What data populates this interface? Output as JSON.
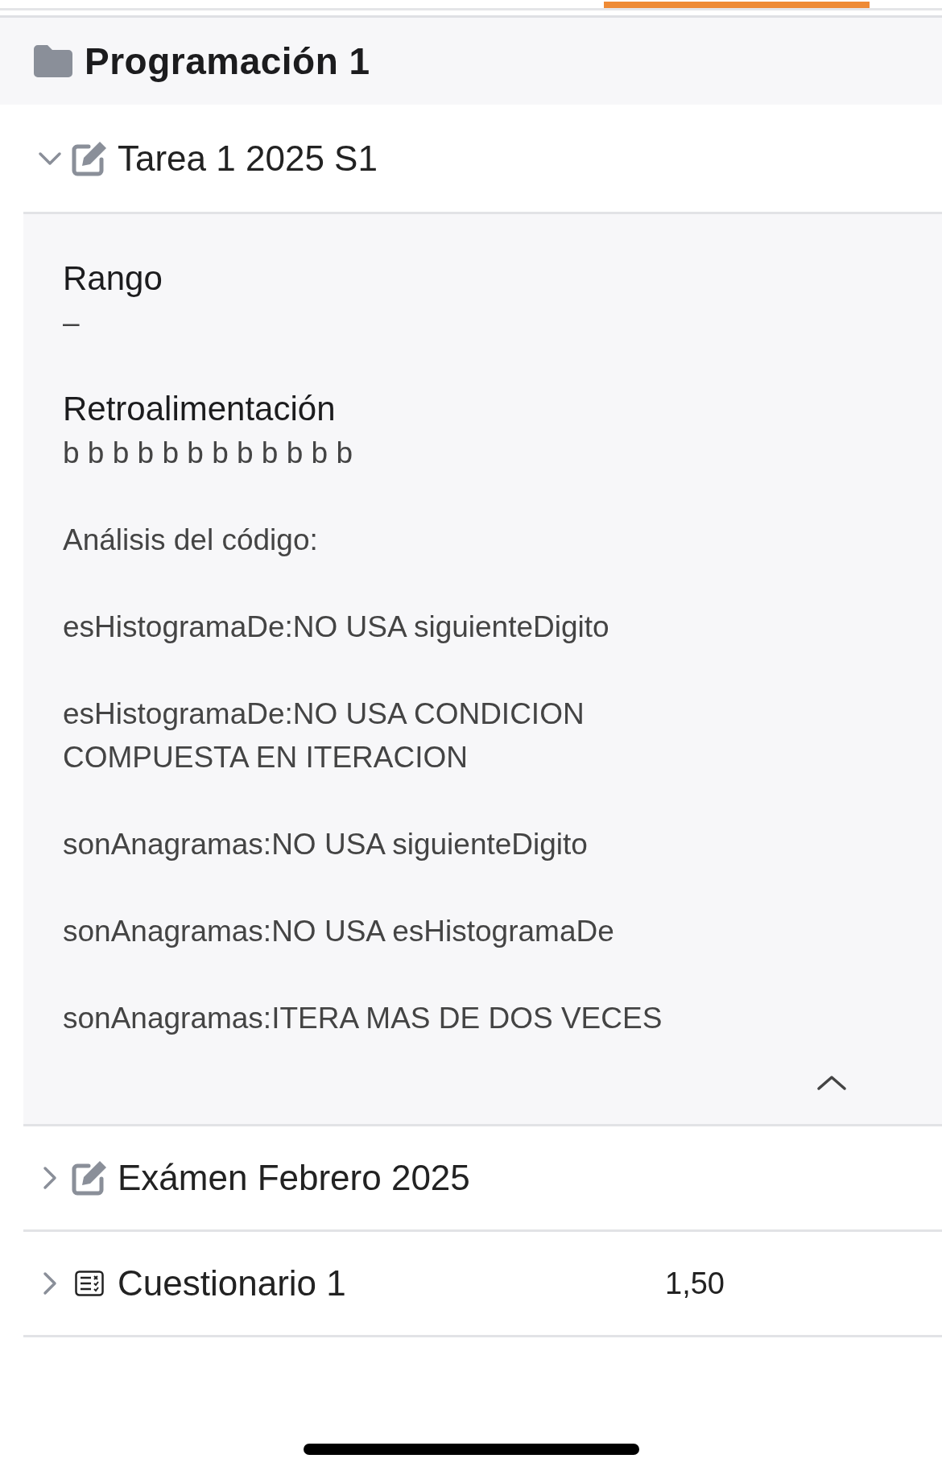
{
  "course": {
    "title": "Programación 1"
  },
  "items": [
    {
      "kind": "assignment",
      "title": "Tarea 1 2025 S1",
      "expanded": true,
      "details": [
        {
          "label": "Rango",
          "paragraphs": [
            "–"
          ]
        },
        {
          "label": "Retroalimentación",
          "paragraphs": [
            "b b b b b b b b b b b b",
            "Análisis del código:",
            "esHistogramaDe:NO USA siguienteDigito",
            "esHistogramaDe:NO USA CONDICION COMPUESTA EN ITERACION",
            "sonAnagramas:NO USA siguienteDigito",
            "sonAnagramas:NO USA esHistogramaDe",
            "sonAnagramas:ITERA MAS DE DOS VECES"
          ]
        }
      ]
    },
    {
      "kind": "assignment",
      "title": "Exámen Febrero 2025",
      "expanded": false
    },
    {
      "kind": "quiz",
      "title": "Cuestionario 1",
      "grade": "1,50",
      "expanded": false
    }
  ]
}
